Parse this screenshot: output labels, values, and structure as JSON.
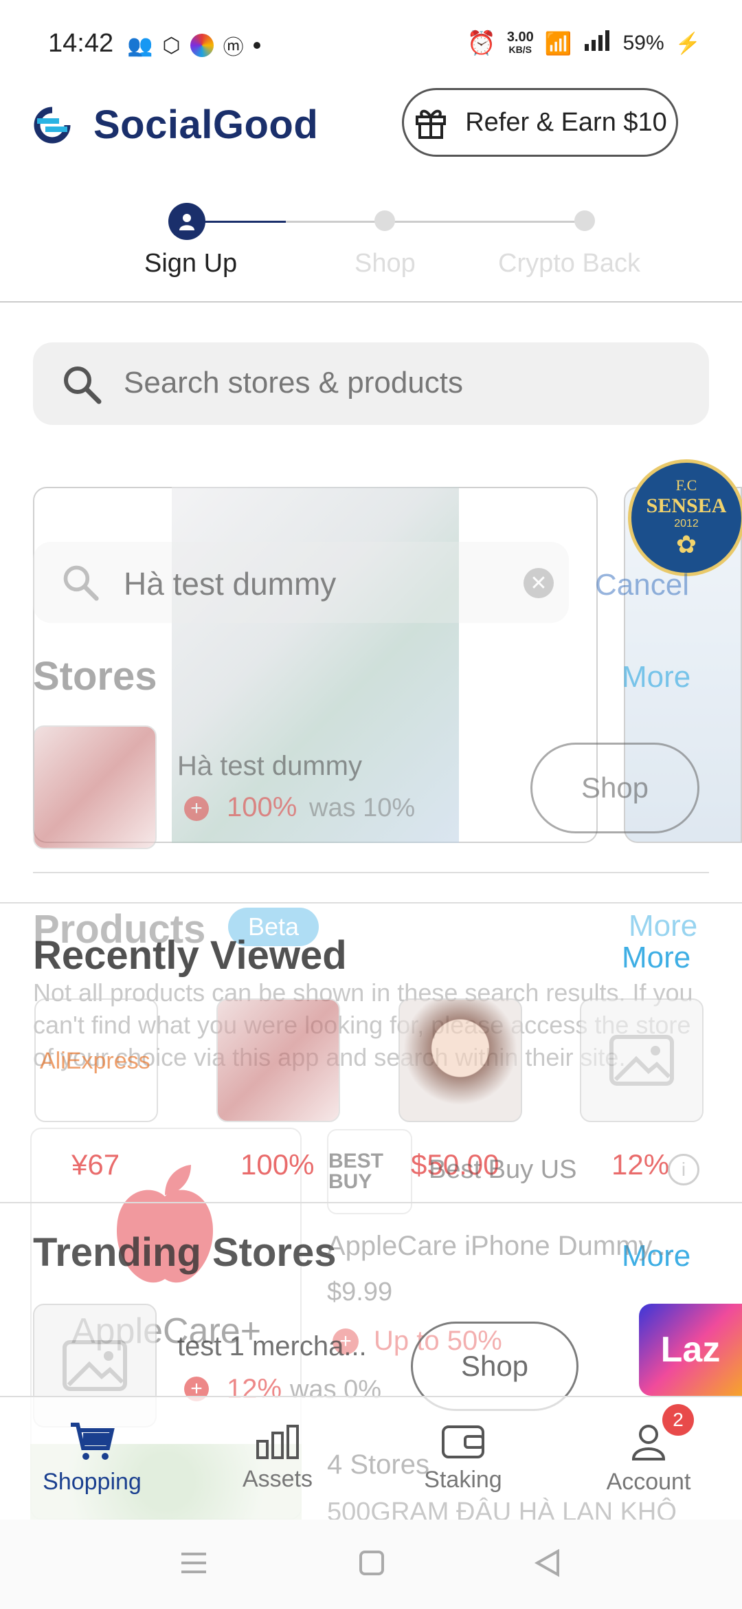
{
  "status_bar": {
    "time": "14:42",
    "speed_value": "3.00",
    "speed_unit": "KB/S",
    "battery": "59%"
  },
  "header": {
    "brand": "SocialGood",
    "refer_label": "Refer & Earn $10"
  },
  "steps": [
    {
      "label": "Sign Up",
      "active": true
    },
    {
      "label": "Shop",
      "active": false
    },
    {
      "label": "Crypto Back",
      "active": false
    }
  ],
  "search": {
    "placeholder": "Search stores & products"
  },
  "overlay_search": {
    "value": "Hà test dummy",
    "cancel": "Cancel"
  },
  "stores": {
    "title": "Stores",
    "more": "More",
    "item": {
      "name": "Hà test dummy",
      "rate": "100%",
      "was": "was 10%",
      "shop": "Shop"
    }
  },
  "featured": {
    "badge_line1": "F.C",
    "badge_line2": "SENSEA",
    "badge_year": "2012"
  },
  "products": {
    "title": "Products",
    "badge": "Beta",
    "more": "More",
    "notice": "Not all products can be shown in these search results. If you can't find what you were looking for, please access the store of your choice via this app and search within their site."
  },
  "recently_viewed": {
    "title": "Recently Viewed",
    "more": "More",
    "items": [
      {
        "label": "AliExpress"
      },
      {
        "label": ""
      },
      {
        "label": ""
      },
      {
        "label": ""
      }
    ],
    "values": [
      "¥67",
      "100%",
      "$50.00",
      "12%"
    ]
  },
  "bestbuy": {
    "logo": "BEST BUY",
    "name": "Best Buy US"
  },
  "trending": {
    "title": "Trending Stores",
    "more": "More",
    "applecare": {
      "brand": "AppleCare+",
      "title": "AppleCare iPhone Dummy...",
      "price": "$9.99",
      "rate": "Up to 50%",
      "shop": "Shop"
    },
    "merchant": {
      "name": "test 1 mercha...",
      "rate": "12%",
      "was": "was 0%"
    },
    "stores_count": "4 Stores",
    "product_line": "500GRAM ĐẬU HÀ LAN KHÔ",
    "laz": "Laz"
  },
  "nav": [
    {
      "label": "Shopping",
      "active": true,
      "icon": "cart-icon"
    },
    {
      "label": "Assets",
      "active": false,
      "icon": "bar-chart-icon"
    },
    {
      "label": "Staking",
      "active": false,
      "icon": "wallet-icon"
    },
    {
      "label": "Account",
      "active": false,
      "icon": "user-icon",
      "badge": "2"
    }
  ],
  "colors": {
    "brand": "#1a2f6b",
    "accent": "#1da1e0",
    "red": "#e23a3a",
    "beta": "#1da1e0"
  }
}
